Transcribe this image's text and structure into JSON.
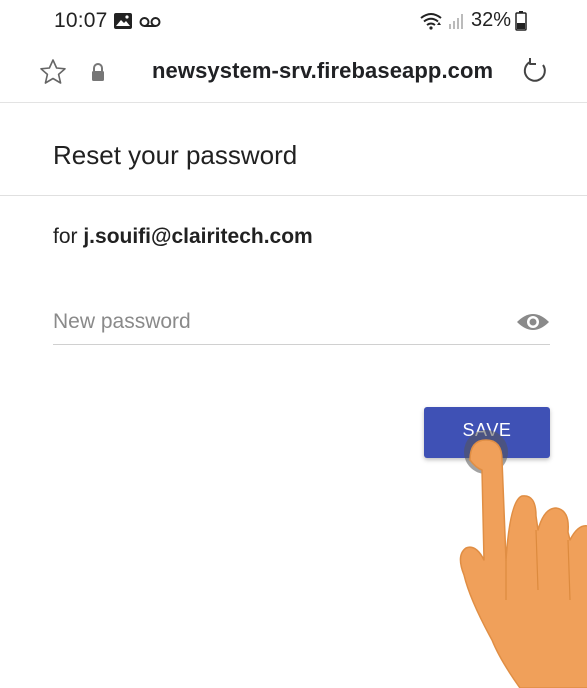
{
  "status_bar": {
    "time": "10:07",
    "battery": "32%",
    "icons": [
      "gallery-icon",
      "voicemail-icon",
      "wifi-icon",
      "signal-icon",
      "battery-icon"
    ]
  },
  "browser": {
    "url": "newsystem-srv.firebaseapp.com",
    "icons": [
      "star-icon",
      "lock-icon",
      "reload-icon"
    ]
  },
  "form": {
    "title": "Reset your password",
    "for_prefix": "for ",
    "email": "j.souifi@clairitech.com",
    "password_placeholder": "New password",
    "password_value": "",
    "save_label": "SAVE"
  },
  "colors": {
    "primary": "#3f51b5",
    "hand": "#f0a05a"
  }
}
